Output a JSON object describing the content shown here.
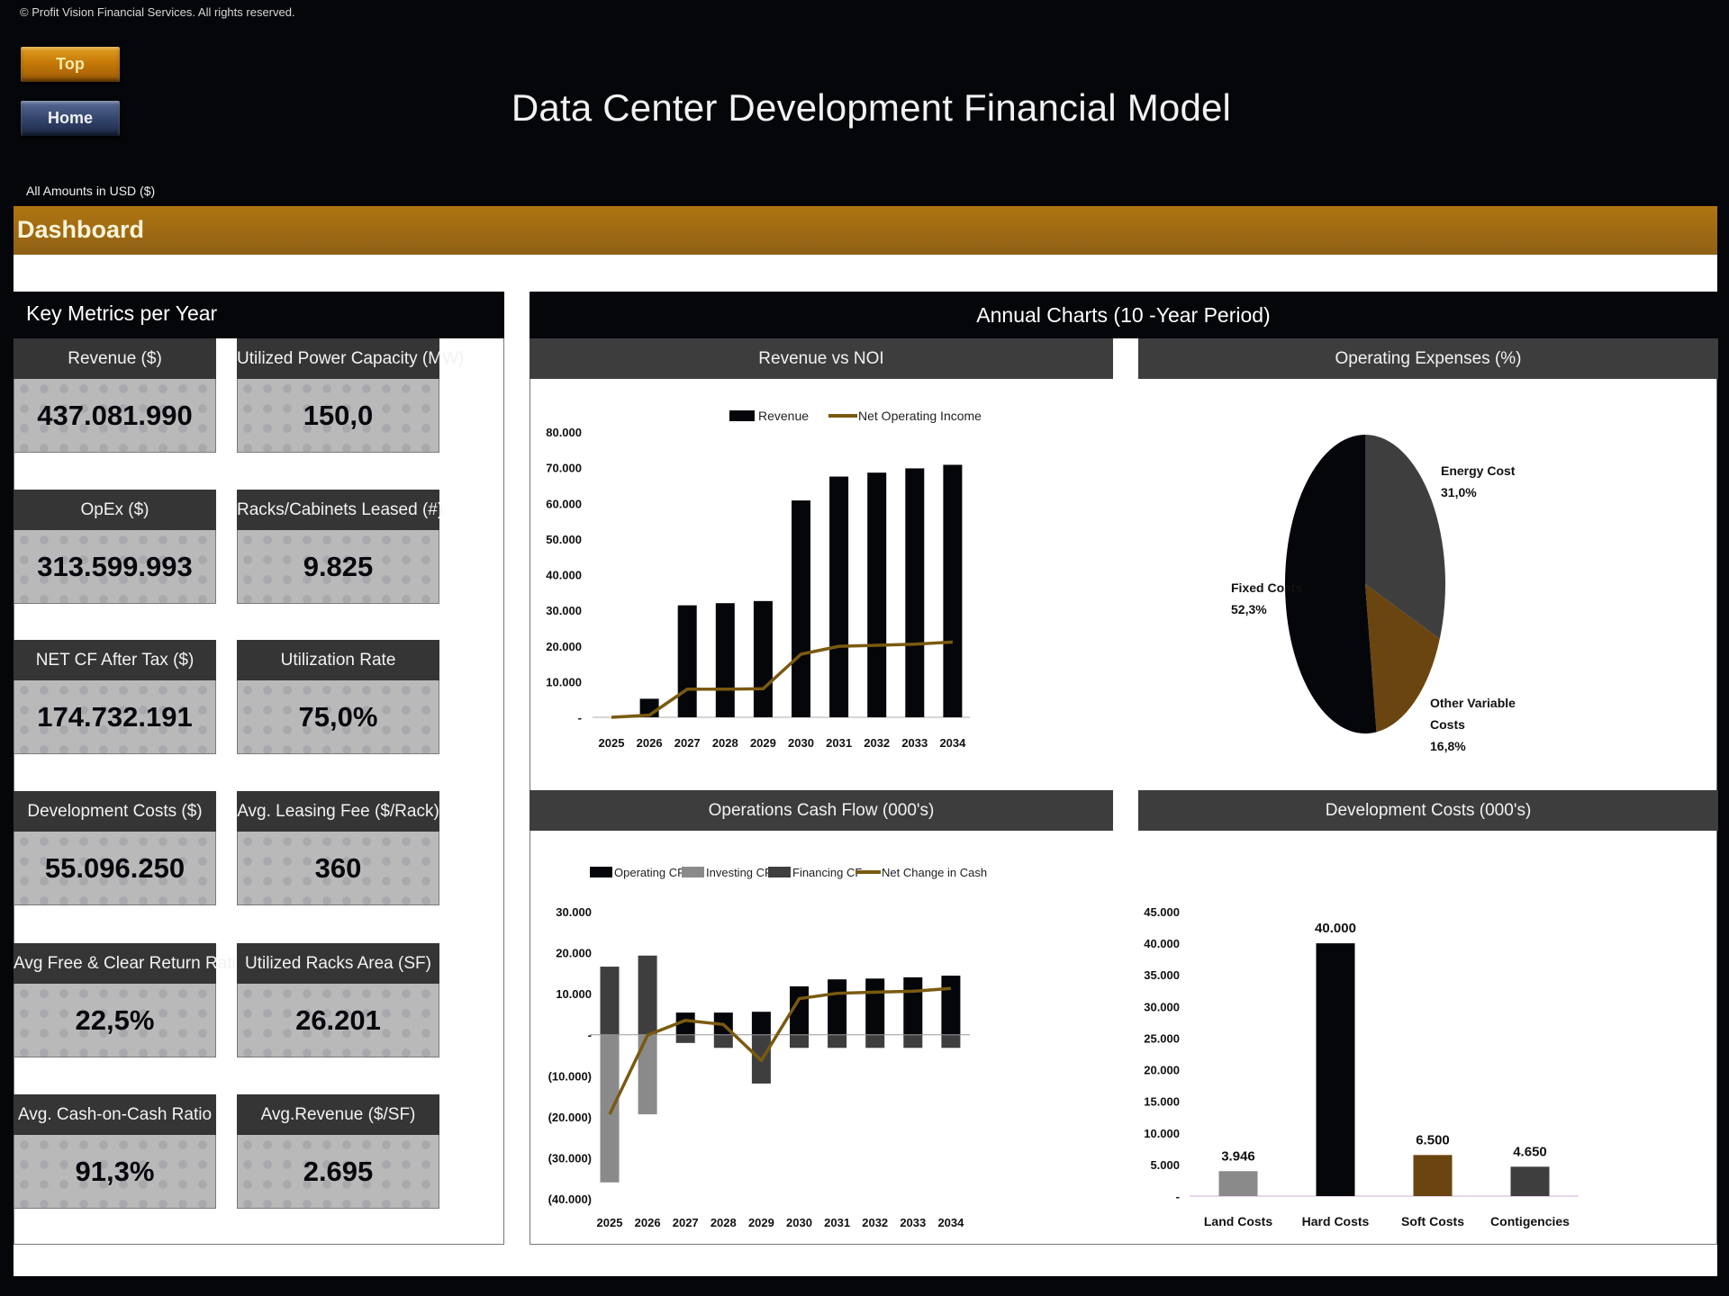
{
  "header": {
    "copyright": "© Profit Vision Financial Services. All rights reserved.",
    "top_button": "Top",
    "home_button": "Home",
    "title": "Data Center Development Financial Model",
    "amounts_note": "All Amounts in  USD ($)",
    "section": "Dashboard"
  },
  "colors": {
    "accent_orange": "#9c6814",
    "series_brown": "#6b4510",
    "line_gold": "#7a5a10",
    "dark": "#05060a",
    "mid_gray": "#3d3d3d",
    "light_gray": "#8a8a8a"
  },
  "key_metrics": {
    "title": "Key Metrics per Year",
    "cards": [
      {
        "label": "Revenue ($)",
        "value": "437.081.990"
      },
      {
        "label": "Utilized Power Capacity (MW)",
        "value": "150,0"
      },
      {
        "label": "OpEx ($)",
        "value": "313.599.993"
      },
      {
        "label": "Racks/Cabinets Leased (#)",
        "value": "9.825"
      },
      {
        "label": "NET CF After Tax ($)",
        "value": "174.732.191"
      },
      {
        "label": "Utilization Rate",
        "value": "75,0%"
      },
      {
        "label": "Development Costs ($)",
        "value": "55.096.250"
      },
      {
        "label": "Avg. Leasing Fee ($/Rack)",
        "value": "360"
      },
      {
        "label": "Avg Free & Clear Return Ration",
        "value": "22,5%"
      },
      {
        "label": "Utilized Racks Area (SF)",
        "value": "26.201"
      },
      {
        "label": "Avg. Cash-on-Cash Ratio",
        "value": "91,3%"
      },
      {
        "label": "Avg.Revenue  ($/SF)",
        "value": "2.695"
      }
    ]
  },
  "charts_section": {
    "title": "Annual Charts (10 -Year Period)"
  },
  "chart_data": [
    {
      "id": "revenue_noi",
      "type": "bar",
      "title": "Revenue vs NOI",
      "categories": [
        "2025",
        "2026",
        "2027",
        "2028",
        "2029",
        "2030",
        "2031",
        "2032",
        "2033",
        "2034"
      ],
      "series": [
        {
          "name": "Revenue",
          "kind": "bar",
          "color": "#05060a",
          "values": [
            0,
            5200,
            31400,
            32000,
            32600,
            60800,
            67500,
            68600,
            69800,
            70800
          ]
        },
        {
          "name": "Net Operating Income",
          "kind": "line",
          "color": "#7a5a10",
          "values": [
            0,
            600,
            7900,
            7900,
            8000,
            17700,
            19900,
            20200,
            20500,
            21100
          ]
        }
      ],
      "yticks": [
        "-",
        "10.000",
        "20.000",
        "30.000",
        "40.000",
        "50.000",
        "60.000",
        "70.000",
        "80.000"
      ],
      "ylim": [
        0,
        80000
      ],
      "legend": "top",
      "grid": false
    },
    {
      "id": "opex_pie",
      "type": "pie",
      "title": "Operating Expenses (%)",
      "slices": [
        {
          "name": "Energy Cost",
          "value": 31.0,
          "label": "31,0%",
          "color": "#3e3e3e"
        },
        {
          "name": "Other Variable Costs",
          "value": 16.8,
          "label": "16,8%",
          "color": "#6b4510"
        },
        {
          "name": "Fixed Costs",
          "value": 52.3,
          "label": "52,3%",
          "color": "#05060a"
        }
      ],
      "label_lines": {
        "energy": [
          "Energy Cost",
          "31,0%"
        ],
        "other": [
          "Other Variable",
          "Costs",
          "16,8%"
        ],
        "fixed": [
          "Fixed Costs",
          "52,3%"
        ]
      }
    },
    {
      "id": "ops_cash_flow",
      "type": "bar",
      "title": "Operations Cash Flow (000's)",
      "categories": [
        "2025",
        "2026",
        "2027",
        "2028",
        "2029",
        "2030",
        "2031",
        "2032",
        "2033",
        "2034"
      ],
      "series": [
        {
          "name": "Operating CF",
          "kind": "bar",
          "color": "#05060a",
          "values": [
            0,
            0,
            5400,
            5400,
            5600,
            11800,
            13500,
            13700,
            14000,
            14400
          ]
        },
        {
          "name": "Investing CF",
          "kind": "bar",
          "color": "#8a8a8a",
          "values": [
            -36000,
            -19400,
            0,
            0,
            0,
            0,
            0,
            0,
            0,
            0
          ]
        },
        {
          "name": "Financing CF",
          "kind": "bar",
          "color": "#3e3e3e",
          "values": [
            16600,
            19300,
            -2000,
            -3200,
            -11900,
            -3200,
            -3200,
            -3200,
            -3200,
            -3200
          ]
        },
        {
          "name": "Net Change in Cash",
          "kind": "line",
          "color": "#7a5a10",
          "values": [
            -19400,
            -100,
            3500,
            2500,
            -6300,
            8800,
            10100,
            10400,
            10600,
            11300
          ]
        }
      ],
      "yticks": [
        "(40.000)",
        "(30.000)",
        "(20.000)",
        "(10.000)",
        "-",
        "10.000",
        "20.000",
        "30.000"
      ],
      "ylim": [
        -40000,
        30000
      ],
      "legend": "top",
      "grid": false
    },
    {
      "id": "dev_costs",
      "type": "bar",
      "title": "Development Costs (000's)",
      "categories": [
        "Land Costs",
        "Hard Costs",
        "Soft Costs",
        "Contigencies"
      ],
      "values": [
        3946,
        40000,
        6500,
        4650
      ],
      "data_labels": [
        "3.946",
        "40.000",
        "6.500",
        "4.650"
      ],
      "colors": [
        "#8a8a8a",
        "#05060a",
        "#6b4510",
        "#3e3e3e"
      ],
      "yticks": [
        "-",
        "5.000",
        "10.000",
        "15.000",
        "20.000",
        "25.000",
        "30.000",
        "35.000",
        "40.000",
        "45.000"
      ],
      "ylim": [
        0,
        45000
      ],
      "grid": false
    }
  ]
}
